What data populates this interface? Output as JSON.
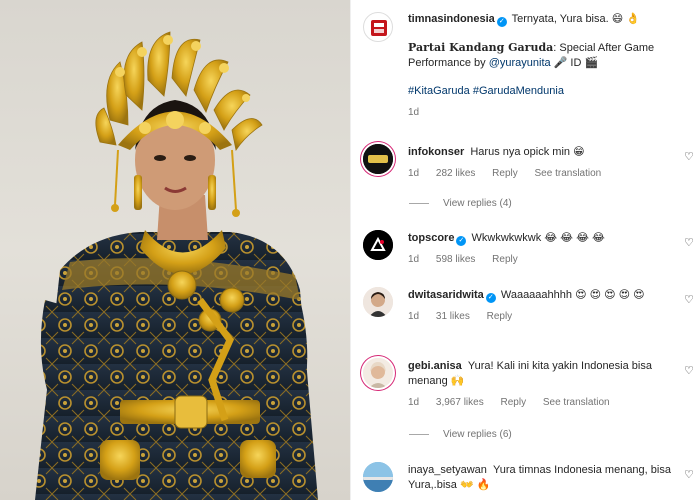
{
  "post": {
    "username": "timnasindonesia",
    "caption_text": "Ternyata, Yura bisa. 😄 👌",
    "caption_title": "Partai Kandang Garuda",
    "caption_rest": ": Special After Game Performance by ",
    "caption_mention": "@yurayunita",
    "caption_tail": " 🎤 ID 🎬",
    "hashtag_1": "#KitaGaruda",
    "hashtag_2": "#GarudaMendunia",
    "time": "1d"
  },
  "comments": [
    {
      "username": "infokonser",
      "verified": false,
      "text": "Harus nya opick min 😁",
      "time": "1d",
      "likes": "282 likes",
      "reply": "Reply",
      "translate": "See translation",
      "view_replies": "View replies (4)"
    },
    {
      "username": "topscore",
      "verified": true,
      "text": "Wkwkwkwkwk 😂 😂 😂 😂",
      "time": "1d",
      "likes": "598 likes",
      "reply": "Reply"
    },
    {
      "username": "dwitasaridwita",
      "verified": true,
      "text": "Waaaaaahhhh 😍 😍 😍 😍 😍",
      "time": "1d",
      "likes": "31 likes",
      "reply": "Reply"
    },
    {
      "username": "gebi.anisa",
      "verified": false,
      "text": "Yura! Kali ini kita yakin Indonesia bisa menang 🙌",
      "time": "1d",
      "likes": "3,967 likes",
      "reply": "Reply",
      "translate": "See translation",
      "view_replies": "View replies (6)"
    },
    {
      "username": "inaya_setyawan",
      "verified": false,
      "text": "Yura timnas Indonesia menang, bisa Yura,.bisa 👐 🔥"
    }
  ],
  "icons": {
    "verified": "verified-badge-icon",
    "like": "heart-icon"
  },
  "colors": {
    "verified": "#0095f6",
    "meta": "#737373",
    "hashtag": "#00376b",
    "gold": "#d4a017",
    "dress": "#1f2a36"
  }
}
